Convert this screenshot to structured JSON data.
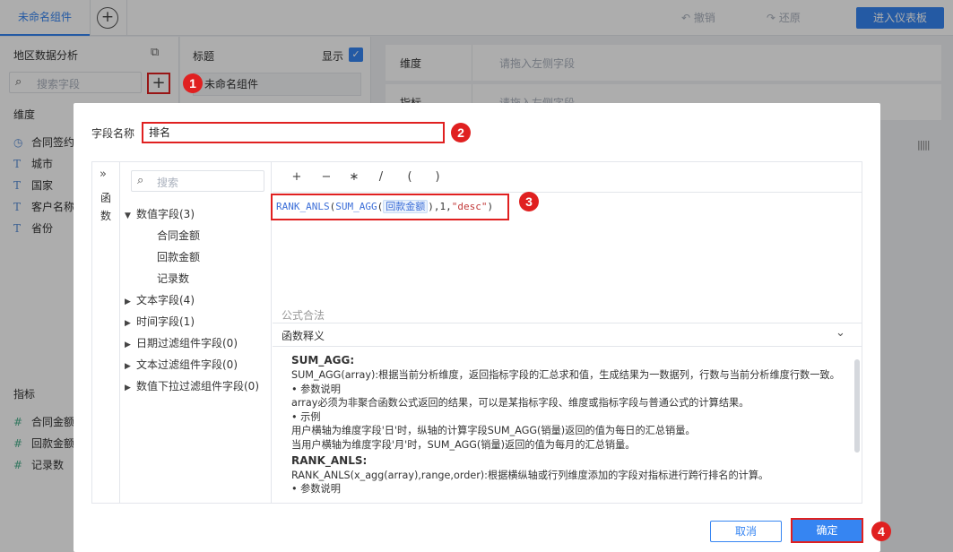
{
  "topbar": {
    "tab_name": "未命名组件",
    "undo": "撤销",
    "redo": "还原",
    "enter_dashboard": "进入仪表板"
  },
  "left_panel": {
    "dataset": "地区数据分析",
    "search_placeholder": "搜索字段",
    "dimension_label": "维度",
    "dimensions": [
      "合同签约",
      "城市",
      "国家",
      "客户名称",
      "省份"
    ],
    "metric_label": "指标",
    "metrics": [
      "合同金额",
      "回款金额",
      "记录数"
    ]
  },
  "mid_panel": {
    "title_label": "标题",
    "show_label": "显示",
    "title_value": "未命名组件"
  },
  "config": {
    "row1_label": "维度",
    "row1_placeholder": "请拖入左侧字段",
    "row2_label": "指标",
    "row2_placeholder": "请拖入左侧字段"
  },
  "dialog": {
    "field_name_label": "字段名称",
    "field_name_value": "排名",
    "function_tab": "函数",
    "tree_search_placeholder": "搜索",
    "tree": [
      {
        "label": "数值字段(3)",
        "expanded": true,
        "children": [
          "合同金额",
          "回款金额",
          "记录数"
        ]
      },
      {
        "label": "文本字段(4)",
        "expanded": false
      },
      {
        "label": "时间字段(1)",
        "expanded": false
      },
      {
        "label": "日期过滤组件字段(0)",
        "expanded": false
      },
      {
        "label": "文本过滤组件字段(0)",
        "expanded": false
      },
      {
        "label": "数值下拉过滤组件字段(0)",
        "expanded": false
      }
    ],
    "operators": [
      "+",
      "−",
      "∗",
      "/",
      "(",
      ")"
    ],
    "formula": {
      "fn_outer": "RANK_ANLS",
      "fn_inner": "SUM_AGG",
      "field": "回款金额",
      "args": ",1,",
      "order": "\"desc\""
    },
    "status": "公式合法",
    "help_title": "函数释义",
    "help": {
      "h1": "SUM_AGG:",
      "l1": "SUM_AGG(array):根据当前分析维度，返回指标字段的汇总求和值，生成结果为一数据列，行数与当前分析维度行数一致。",
      "l2": "• 参数说明",
      "l3": "array必须为非聚合函数公式返回的结果，可以是某指标字段、维度或指标字段与普通公式的计算结果。",
      "l4": "• 示例",
      "l5": "用户横轴为维度字段'日'时，纵轴的计算字段SUM_AGG(销量)返回的值为每日的汇总销量。",
      "l6": "当用户横轴为维度字段'月'时，SUM_AGG(销量)返回的值为每月的汇总销量。",
      "h2": "RANK_ANLS:",
      "l7": "RANK_ANLS(x_agg(array),range,order):根据横纵轴或行列维度添加的字段对指标进行跨行排名的计算。",
      "l8": "• 参数说明"
    },
    "cancel": "取消",
    "ok": "确定"
  },
  "steps": [
    "1",
    "2",
    "3",
    "4"
  ],
  "colors": {
    "accent": "#3685f2",
    "highlight": "#e02020",
    "string": "#c23a3a"
  }
}
